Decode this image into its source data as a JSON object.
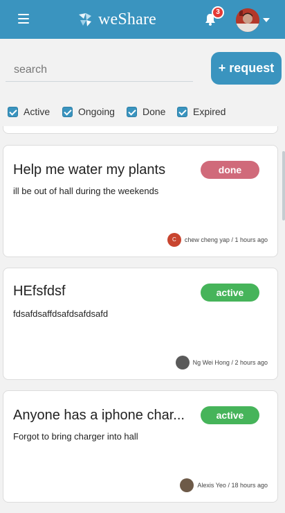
{
  "header": {
    "brand": "weShare",
    "notification_count": "3"
  },
  "search": {
    "placeholder": "search"
  },
  "request_button": "+ request",
  "filters": [
    {
      "label": "Active",
      "checked": true
    },
    {
      "label": "Ongoing",
      "checked": true
    },
    {
      "label": "Done",
      "checked": true
    },
    {
      "label": "Expired",
      "checked": true
    }
  ],
  "requests": [
    {
      "title": "Help me water my plants",
      "description": "ill be out of hall during the weekends",
      "status": "done",
      "author": "chew cheng yap",
      "author_initial": "C",
      "time": "1 hours ago"
    },
    {
      "title": "HEfsfdsf",
      "description": "fdsafdsaffdsafdsafdsafd",
      "status": "active",
      "author": "Ng Wei Hong",
      "author_initial": "",
      "time": "2 hours ago"
    },
    {
      "title": "Anyone has a iphone char...",
      "description": "Forgot to bring charger into hall",
      "status": "active",
      "author": "Alexis Yeo",
      "author_initial": "",
      "time": "18 hours ago"
    }
  ],
  "colors": {
    "primary": "#3a94bf",
    "done": "#d06a7a",
    "active": "#46b45a",
    "badge": "#e53935"
  }
}
